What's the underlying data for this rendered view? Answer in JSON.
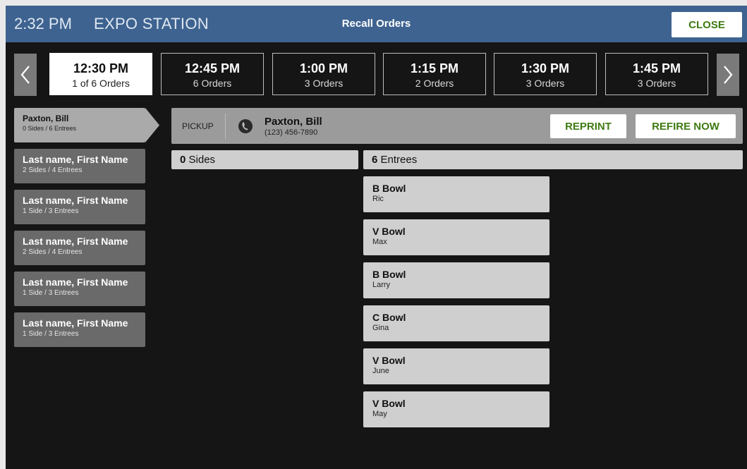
{
  "header": {
    "time": "2:32 PM",
    "station": "EXPO STATION",
    "title": "Recall Orders",
    "close_label": "CLOSE"
  },
  "time_slots": [
    {
      "time": "12:30 PM",
      "count": "1 of 6 Orders",
      "active": true
    },
    {
      "time": "12:45 PM",
      "count": "6 Orders"
    },
    {
      "time": "1:00 PM",
      "count": "3 Orders"
    },
    {
      "time": "1:15 PM",
      "count": "2 Orders"
    },
    {
      "time": "1:30 PM",
      "count": "3 Orders"
    },
    {
      "time": "1:45 PM",
      "count": "3 Orders"
    }
  ],
  "customers": [
    {
      "name": "Paxton, Bill",
      "summary": "0 Sides / 6 Entrees",
      "active": true
    },
    {
      "name": "Last name, First Name",
      "summary": "2 Sides / 4 Entrees"
    },
    {
      "name": "Last name, First Name",
      "summary": "1 Side / 3 Entrees"
    },
    {
      "name": "Last name, First Name",
      "summary": "2 Sides / 4 Entrees"
    },
    {
      "name": "Last name, First Name",
      "summary": "1 Side / 3 Entrees"
    },
    {
      "name": "Last name, First Name",
      "summary": "1 Side / 3 Entrees"
    }
  ],
  "order": {
    "type": "PICKUP",
    "name": "Paxton, Bill",
    "phone": "(123) 456-7890",
    "reprint_label": "REPRINT",
    "refire_label": "REFIRE NOW"
  },
  "sides": {
    "count": "0",
    "label": "Sides"
  },
  "entrees": {
    "count": "6",
    "label": "Entrees",
    "items": [
      {
        "name": "B Bowl",
        "for": "Ric"
      },
      {
        "name": "V Bowl",
        "for": "Max"
      },
      {
        "name": "B Bowl",
        "for": "Larry"
      },
      {
        "name": "C Bowl",
        "for": "Gina"
      },
      {
        "name": "V Bowl",
        "for": "June"
      },
      {
        "name": "V Bowl",
        "for": "May"
      }
    ]
  },
  "colors": {
    "header_bg": "#3e6390",
    "accent_green": "#3e7b12",
    "panel_bg": "#151515"
  }
}
